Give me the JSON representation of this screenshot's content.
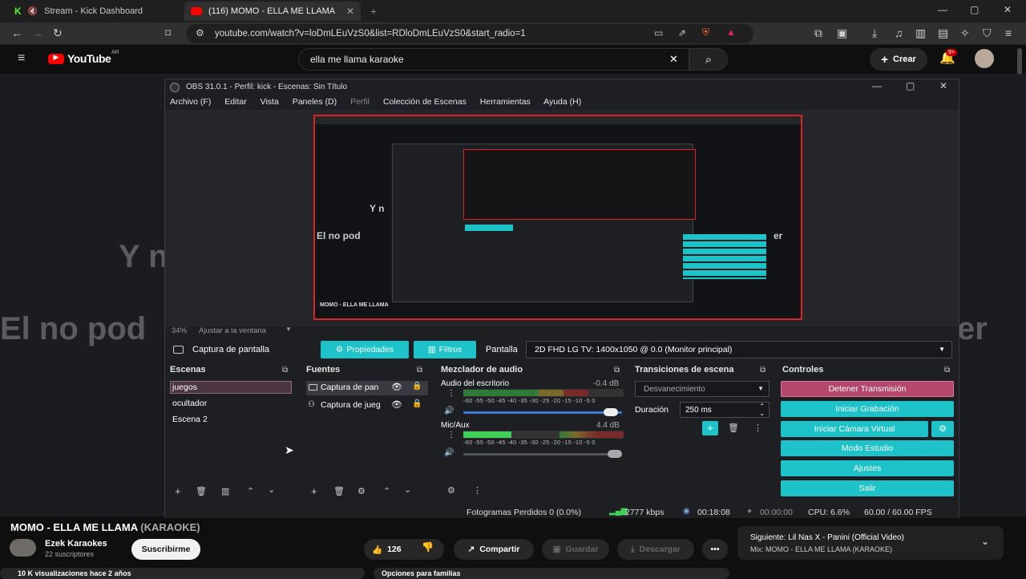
{
  "browser": {
    "tabs": [
      {
        "title": "Stream - Kick Dashboard"
      },
      {
        "title": "(116) MOMO - ELLA ME LLAMA"
      }
    ],
    "url": "youtube.com/watch?v=loDmLEuVzS0&list=RDloDmLEuVzS0&start_radio=1"
  },
  "youtube": {
    "logo": "YouTube",
    "country": "AR",
    "search_value": "ella me llama karaoke",
    "create_label": "Crear",
    "notif_badge": "9+",
    "video_title": "MOMO - ELLA ME LLAMA",
    "video_title_suffix": "(KARAOKE)",
    "channel": "Ezek Karaokes",
    "subscribers": "22 suscriptores",
    "subscribe": "Suscribirme",
    "likes": "126",
    "share": "Compartir",
    "save": "Guardar",
    "download": "Descargar",
    "views": "10 K visualizaciones  hace 2 años",
    "family": "Opciones para familias",
    "next_title": "Siguiente: Lil Nas X - Panini (Official Video)",
    "mix_title": "Mix: MOMO - ELLA ME LLAMA (KARAOKE)",
    "lyrics_line1": "Y n",
    "lyrics_line2": "El no pod",
    "lyrics_right": "er"
  },
  "obs": {
    "title": "OBS 31.0.1 - Perfil: kick - Escenas: Sin Título",
    "menu": [
      "Archivo (F)",
      "Editar",
      "Vista",
      "Paneles (D)",
      "Perfil",
      "Colección de Escenas",
      "Herramientas",
      "Ayuda (H)"
    ],
    "zoom": "34%",
    "fit": "Ajustar a la ventana",
    "source_bar": {
      "source": "Captura de pantalla",
      "properties": "Propiedades",
      "filters": "Filtros",
      "screen_label": "Pantalla",
      "screen_value": "2D FHD LG TV: 1400x1050 @ 0.0 (Monitor principal)"
    },
    "scenes": {
      "title": "Escenas",
      "items": [
        "juegos",
        "ocultador",
        "Escena 2"
      ]
    },
    "sources": {
      "title": "Fuentes",
      "items": [
        "Captura de pan",
        "Captura de jueg"
      ]
    },
    "mixer": {
      "title": "Mezclador de audio",
      "channels": [
        {
          "name": "Audio del escritorio",
          "db": "-0.4 dB",
          "level": 0.78,
          "volume": 0.97
        },
        {
          "name": "Mic/Aux",
          "db": "4.4 dB",
          "level": 0.3,
          "volume": 1.0
        }
      ],
      "scale": "-60 -55 -50 -45 -40 -35 -30 -25 -20 -15 -10 -5 0"
    },
    "transitions": {
      "title": "Transiciones de escena",
      "type": "Desvanecimiento",
      "duration_label": "Duración",
      "duration_value": "250 ms"
    },
    "controls": {
      "title": "Controles",
      "buttons": [
        "Detener Transmisión",
        "Iniciar Grabación",
        "Iniciar Cámara Virtual",
        "Modo Estudio",
        "Ajustes",
        "Salir"
      ]
    },
    "status": {
      "dropped": "Fotogramas Perdidos 0 (0.0%)",
      "bitrate": "2777 kbps",
      "stream_time": "00:18:08",
      "rec_time": "00:00:00",
      "cpu": "CPU: 6.6%",
      "fps": "60.00 / 60.00 FPS"
    }
  },
  "colors": {
    "accent": "#1ec3c9",
    "stop_button": "#b5476d",
    "youtube_red": "#ff0000"
  }
}
